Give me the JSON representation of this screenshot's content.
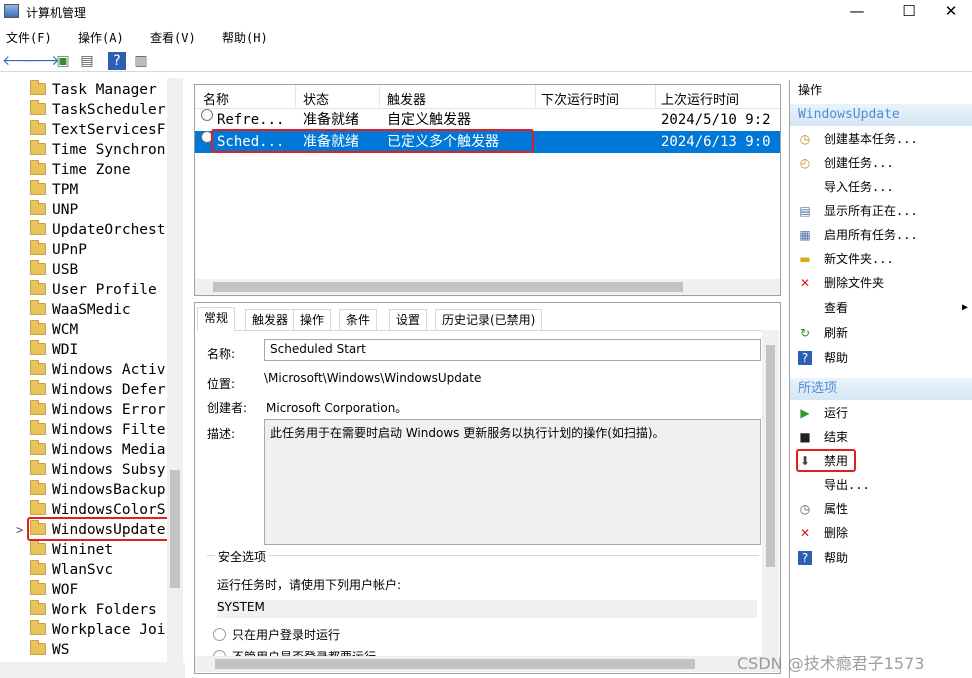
{
  "window": {
    "title": "计算机管理",
    "min": "—",
    "max": "☐",
    "close": "✕"
  },
  "menu": [
    "文件(F)",
    "操作(A)",
    "查看(V)",
    "帮助(H)"
  ],
  "tree": {
    "items": [
      "Task Manager",
      "TaskScheduler",
      "TextServicesF",
      "Time Synchron",
      "Time Zone",
      "TPM",
      "UNP",
      "UpdateOrchest",
      "UPnP",
      "USB",
      "User Profile",
      "WaaSMedic",
      "WCM",
      "WDI",
      "Windows Activ",
      "Windows Defer",
      "Windows Error",
      "Windows Filte",
      "Windows Media",
      "Windows Subsy",
      "WindowsBackup",
      "WindowsColorS",
      "WindowsUpdate",
      "Wininet",
      "WlanSvc",
      "WOF",
      "Work Folders",
      "Workplace Joi",
      "WS"
    ],
    "selected": "WindowsUpdate",
    "expander": ">"
  },
  "task_list": {
    "columns": [
      "名称",
      "状态",
      "触发器",
      "下次运行时间",
      "上次运行时间"
    ],
    "rows": [
      {
        "name": "Refre...",
        "status": "准备就绪",
        "trigger": "自定义触发器",
        "next": "",
        "last": "2024/5/10 9:2"
      },
      {
        "name": "Sched...",
        "status": "准备就绪",
        "trigger": "已定义多个触发器",
        "next": "",
        "last": "2024/6/13 9:0"
      }
    ]
  },
  "detail": {
    "tabs": [
      "常规",
      "触发器",
      "操作",
      "条件",
      "设置",
      "历史记录(已禁用)"
    ],
    "name_label": "名称:",
    "name_value": "Scheduled Start",
    "location_label": "位置:",
    "location_value": "\\Microsoft\\Windows\\WindowsUpdate",
    "author_label": "创建者:",
    "author_value": "Microsoft Corporation。",
    "desc_label": "描述:",
    "desc_value": "此任务用于在需要时启动 Windows 更新服务以执行计划的操作(如扫描)。",
    "security_title": "安全选项",
    "run_as_label": "运行任务时，请使用下列用户帐户:",
    "run_as_value": "SYSTEM",
    "radio1": "只在用户登录时运行",
    "radio2": "不管用户是否登录都要运行"
  },
  "actions": {
    "header": "操作",
    "section1": "WindowsUpdate",
    "items1": [
      "创建基本任务...",
      "创建任务...",
      "导入任务...",
      "显示所有正在...",
      "启用所有任务...",
      "新文件夹...",
      "删除文件夹",
      "查看",
      "刷新",
      "帮助"
    ],
    "section2": "所选项",
    "items2": [
      "运行",
      "结束",
      "禁用",
      "导出...",
      "属性",
      "删除",
      "帮助"
    ]
  },
  "watermark": "CSDN @技术瘾君子1573",
  "colors": {
    "selection": "#0078d7",
    "highlight_box": "#e02020",
    "section_text": "#4a8fd1"
  }
}
